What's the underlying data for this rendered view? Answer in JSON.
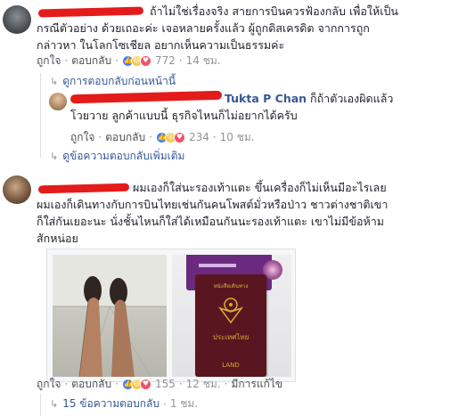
{
  "comment1": {
    "text_line1": "ถ้าไม่ใช่เรื่องจริง สายการบินควรฟ้องกลับ เพื่อให้เป็น",
    "text_line2": "กรณีตัวอย่าง ด้วยเถอะค่ะ เจอหลายครั้งแล้ว ผู้ถูกดิสเครดิต จากการถูก",
    "text_line3": "กล่าวหา ในโลกโซเชียล อยากเห็นความเป็นธรรมค่ะ",
    "like_label": "ถูกใจ",
    "reply_label": "ตอบกลับ",
    "reaction_count": "772",
    "time": "14 ชม."
  },
  "previous_replies": "ดูการตอบกลับก่อนหน้านี้",
  "reply1": {
    "tag_name": "Tukta P Chan",
    "text_line1": "ก็ถ้าตัวเองผิดแล้ว",
    "text_line2": "โวยวาย ลูกค้าแบบนี้ ธุรกิจไหนก็ไม่อยากได้ครับ",
    "like_label": "ถูกใจ",
    "reply_label": "ตอบกลับ",
    "reaction_count": "234",
    "time": "10 ชม."
  },
  "more_replies": "ดูข้อความตอบกลับเพิ่มเติม",
  "comment2": {
    "text_line1": "ผมเองก็ใส่นะรองเท้าแตะ ขึ้นเครื่องก็ไม่เห็นมีอะไรเลย",
    "text_line2": "ผมเองก็เดินทางกับการบินไทยเช่นกันคนโพสต์มั่วหรือป่าว ชาวต่างชาติเขา",
    "text_line3": "ก็ใส่กันเยอะนะ นั่งชั้นไหนก็ใส่ได้เหมือนกันนะรองเท้าแตะ เขาไม่มีข้อห้าม",
    "text_line4": "สักหน่อย",
    "passport_top": "หนังสือเดินทาง",
    "passport_country": "ประเทศไทย",
    "passport_bottom": "LAND",
    "like_label": "ถูกใจ",
    "reply_label": "ตอบกลับ",
    "reaction_count": "155",
    "time": "12 ชม.",
    "edited_label": "มีการแก้ไข"
  },
  "reply_count_link": "15 ข้อความตอบกลับ",
  "reply_count_time": "1 ชม.",
  "colors": {
    "link": "#365899",
    "meta": "#90949c",
    "redaction": "#e41b1b",
    "passport": "#5a1620"
  }
}
